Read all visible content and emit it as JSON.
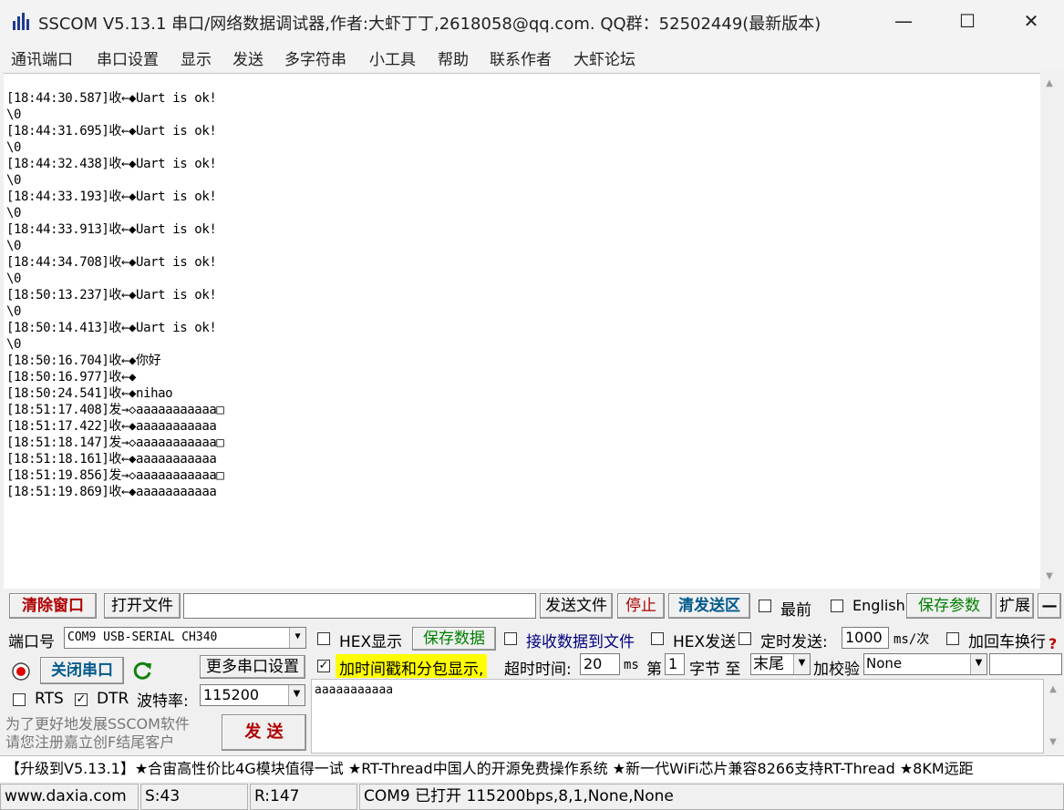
{
  "window": {
    "title": "SSCOM V5.13.1 串口/网络数据调试器,作者:大虾丁丁,2618058@qq.com. QQ群：52502449(最新版本)",
    "minimize": "—",
    "maximize": "☐",
    "close": "✕"
  },
  "menu": [
    "通讯端口",
    "串口设置",
    "显示",
    "发送",
    "多字符串",
    "小工具",
    "帮助",
    "联系作者",
    "大虾论坛"
  ],
  "receive_log": [
    "[18:44:30.587]收←◆Uart is ok!",
    "\\0",
    "[18:44:31.695]收←◆Uart is ok!",
    "\\0",
    "[18:44:32.438]收←◆Uart is ok!",
    "\\0",
    "[18:44:33.193]收←◆Uart is ok!",
    "\\0",
    "[18:44:33.913]收←◆Uart is ok!",
    "\\0",
    "[18:44:34.708]收←◆Uart is ok!",
    "\\0",
    "[18:50:13.237]收←◆Uart is ok!",
    "\\0",
    "[18:50:14.413]收←◆Uart is ok!",
    "\\0",
    "[18:50:16.704]收←◆你好",
    "[18:50:16.977]收←◆",
    "[18:50:24.541]收←◆nihao",
    "[18:51:17.408]发→◇aaaaaaaaaaa□",
    "[18:51:17.422]收←◆aaaaaaaaaaa",
    "[18:51:18.147]发→◇aaaaaaaaaaa□",
    "[18:51:18.161]收←◆aaaaaaaaaaa",
    "[18:51:19.856]发→◇aaaaaaaaaaa□",
    "[18:51:19.869]收←◆aaaaaaaaaaa"
  ],
  "toolbar": {
    "clear_window": "清除窗口",
    "open_file": "打开文件",
    "file_path": "",
    "send_file": "发送文件",
    "stop": "停止",
    "clear_send": "清发送区",
    "topmost": "最前",
    "english": "English",
    "save_params": "保存参数",
    "expand": "扩展",
    "collapse": "—"
  },
  "port": {
    "port_label": "端口号",
    "port_value": "COM9 USB-SERIAL CH340",
    "hex_display": "HEX显示",
    "save_data": "保存数据",
    "recv_to_file": "接收数据到文件",
    "hex_send": "HEX发送",
    "timed_send": "定时发送:",
    "interval": "1000",
    "interval_unit": "ms/次",
    "add_crlf": "加回车换行",
    "close_port": "关闭串口",
    "more_settings": "更多串口设置",
    "timestamp": "加时间戳和分包显示,",
    "timeout_label": "超时时间:",
    "timeout_value": "20",
    "timeout_unit": "ms",
    "byte_prefix": "第",
    "byte_index": "1",
    "byte_mid": "字节 至",
    "byte_end": "末尾",
    "checksum_label": "加校验",
    "checksum_value": "None",
    "rts": "RTS",
    "dtr": "DTR",
    "baud_label": "波特率:",
    "baud_value": "115200",
    "send_text": "aaaaaaaaaaa",
    "promo": "为了更好地发展SSCOM软件\n请您注册嘉立创F结尾客户",
    "send": "发  送"
  },
  "ticker": "【升级到V5.13.1】★合宙高性价比4G模块值得一试 ★RT-Thread中国人的开源免费操作系统 ★新一代WiFi芯片兼容8266支持RT-Thread ★8KM远距",
  "status": {
    "website": "www.daxia.com",
    "sent": "S:43",
    "received": "R:147",
    "port_state": "COM9 已打开  115200bps,8,1,None,None"
  },
  "colors": {
    "accent_red": "#b00000",
    "accent_green": "#008000",
    "highlight_yellow": "#ffff00"
  }
}
